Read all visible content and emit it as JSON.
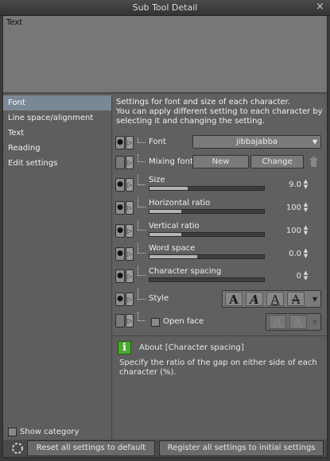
{
  "window": {
    "title": "Sub Tool Detail",
    "close": "×"
  },
  "preview": {
    "text": "Text"
  },
  "categories": {
    "items": [
      {
        "label": "Font",
        "selected": true
      },
      {
        "label": "Line space/alignment"
      },
      {
        "label": "Text"
      },
      {
        "label": "Reading"
      },
      {
        "label": "Edit settings"
      }
    ],
    "show_category": "Show category"
  },
  "description": "Settings for font and size of each character.\nYou can apply different setting to each character by selecting it and changing the setting.",
  "settings": {
    "font": {
      "label": "Font",
      "value": "jibbajabba"
    },
    "mixing_font": {
      "label": "Mixing font",
      "new": "New",
      "change": "Change"
    },
    "size": {
      "label": "Size",
      "value": "9.0",
      "fill": 0.33
    },
    "horizontal_ratio": {
      "label": "Horizontal ratio",
      "value": "100",
      "fill": 0.28
    },
    "vertical_ratio": {
      "label": "Vertical ratio",
      "value": "100",
      "fill": 0.28
    },
    "word_space": {
      "label": "Word space",
      "value": "0.0",
      "fill": 0.42
    },
    "character_spacing": {
      "label": "Character spacing",
      "value": "0",
      "fill": 0.0
    },
    "style": {
      "label": "Style",
      "glyph": "A"
    },
    "open_face": {
      "label": "Open face"
    }
  },
  "info": {
    "title": "About [Character spacing]",
    "text": "Specify the ratio of the gap on either side of each character (%).",
    "icon": "i"
  },
  "footer": {
    "reset": "Reset all settings to default",
    "register": "Register all settings to initial settings"
  }
}
